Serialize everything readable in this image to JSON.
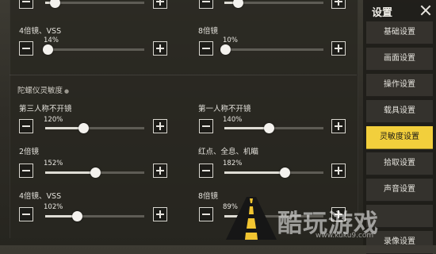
{
  "sidebar": {
    "title": "设置",
    "items": [
      {
        "label": "基础设置",
        "active": false
      },
      {
        "label": "画面设置",
        "active": false
      },
      {
        "label": "操作设置",
        "active": false
      },
      {
        "label": "载具设置",
        "active": false
      },
      {
        "label": "灵敏度设置",
        "active": true
      },
      {
        "label": "拾取设置",
        "active": false
      },
      {
        "label": "声音设置",
        "active": false
      },
      {
        "label": "",
        "active": false
      },
      {
        "label": "录像设置",
        "active": false
      }
    ]
  },
  "top_rows": {
    "left": [
      {
        "label": "",
        "value": "",
        "fraction": 0.0
      },
      {
        "label": "4倍镜、VSS",
        "value": "14%",
        "fraction": 0.02
      }
    ],
    "right": [
      {
        "label": "",
        "value": "",
        "fraction": 0.1
      },
      {
        "label": "8倍镜",
        "value": "10%",
        "fraction": 0.0
      }
    ]
  },
  "gyro_section": {
    "title": "陀螺仪灵敏度",
    "left": [
      {
        "label": "第三人称不开镜",
        "value": "120%",
        "fraction": 0.35
      },
      {
        "label": "2倍镜",
        "value": "152%",
        "fraction": 0.5
      },
      {
        "label": "4倍镜、VSS",
        "value": "102%",
        "fraction": 0.26
      }
    ],
    "right": [
      {
        "label": "第一人称不开镜",
        "value": "140%",
        "fraction": 0.44
      },
      {
        "label": "红点、全息、机瞄",
        "value": "182%",
        "fraction": 0.64
      },
      {
        "label": "8倍镜",
        "value": "89%",
        "fraction": 0.19
      }
    ]
  },
  "watermark": {
    "text": "酷玩游戏",
    "url": "www.kuku9.com"
  },
  "colors": {
    "accent": "#f2cf3c",
    "sidebar_bg": "#1e1d19"
  }
}
